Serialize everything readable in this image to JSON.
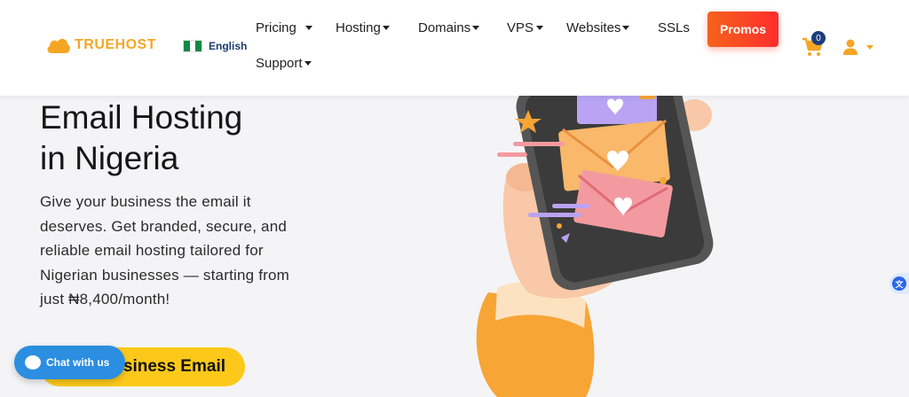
{
  "header": {
    "logo_text": "TRUEHOST",
    "language": "English",
    "nav": {
      "pricing": "Pricing",
      "hosting": "Hosting",
      "domains": "Domains",
      "vps": "VPS",
      "websites": "Websites",
      "ssls": "SSLs",
      "support": "Support"
    },
    "promos_label": "Promos",
    "cart_count": "0"
  },
  "hero": {
    "title_line1": "Email Hosting",
    "title_line2": "in Nigeria",
    "description": "Give your business the email it deserves. Get branded, secure, and reliable email hosting tailored for Nigerian businesses — starting from just ₦8,400/month!",
    "cta_label": "Business Email"
  },
  "chat_label": "Chat with us",
  "colors": {
    "brand_orange": "#f5a623",
    "promos_start": "#f5631c",
    "promos_end": "#ff2d2d",
    "cta_yellow": "#fcc91a",
    "chat_blue": "#2b8ee0",
    "badge_navy": "#1d3d7a"
  },
  "icons": [
    "cloud-logo-icon",
    "nigeria-flag-icon",
    "cart-icon",
    "user-icon",
    "chat-bubble-icon",
    "translate-icon"
  ]
}
